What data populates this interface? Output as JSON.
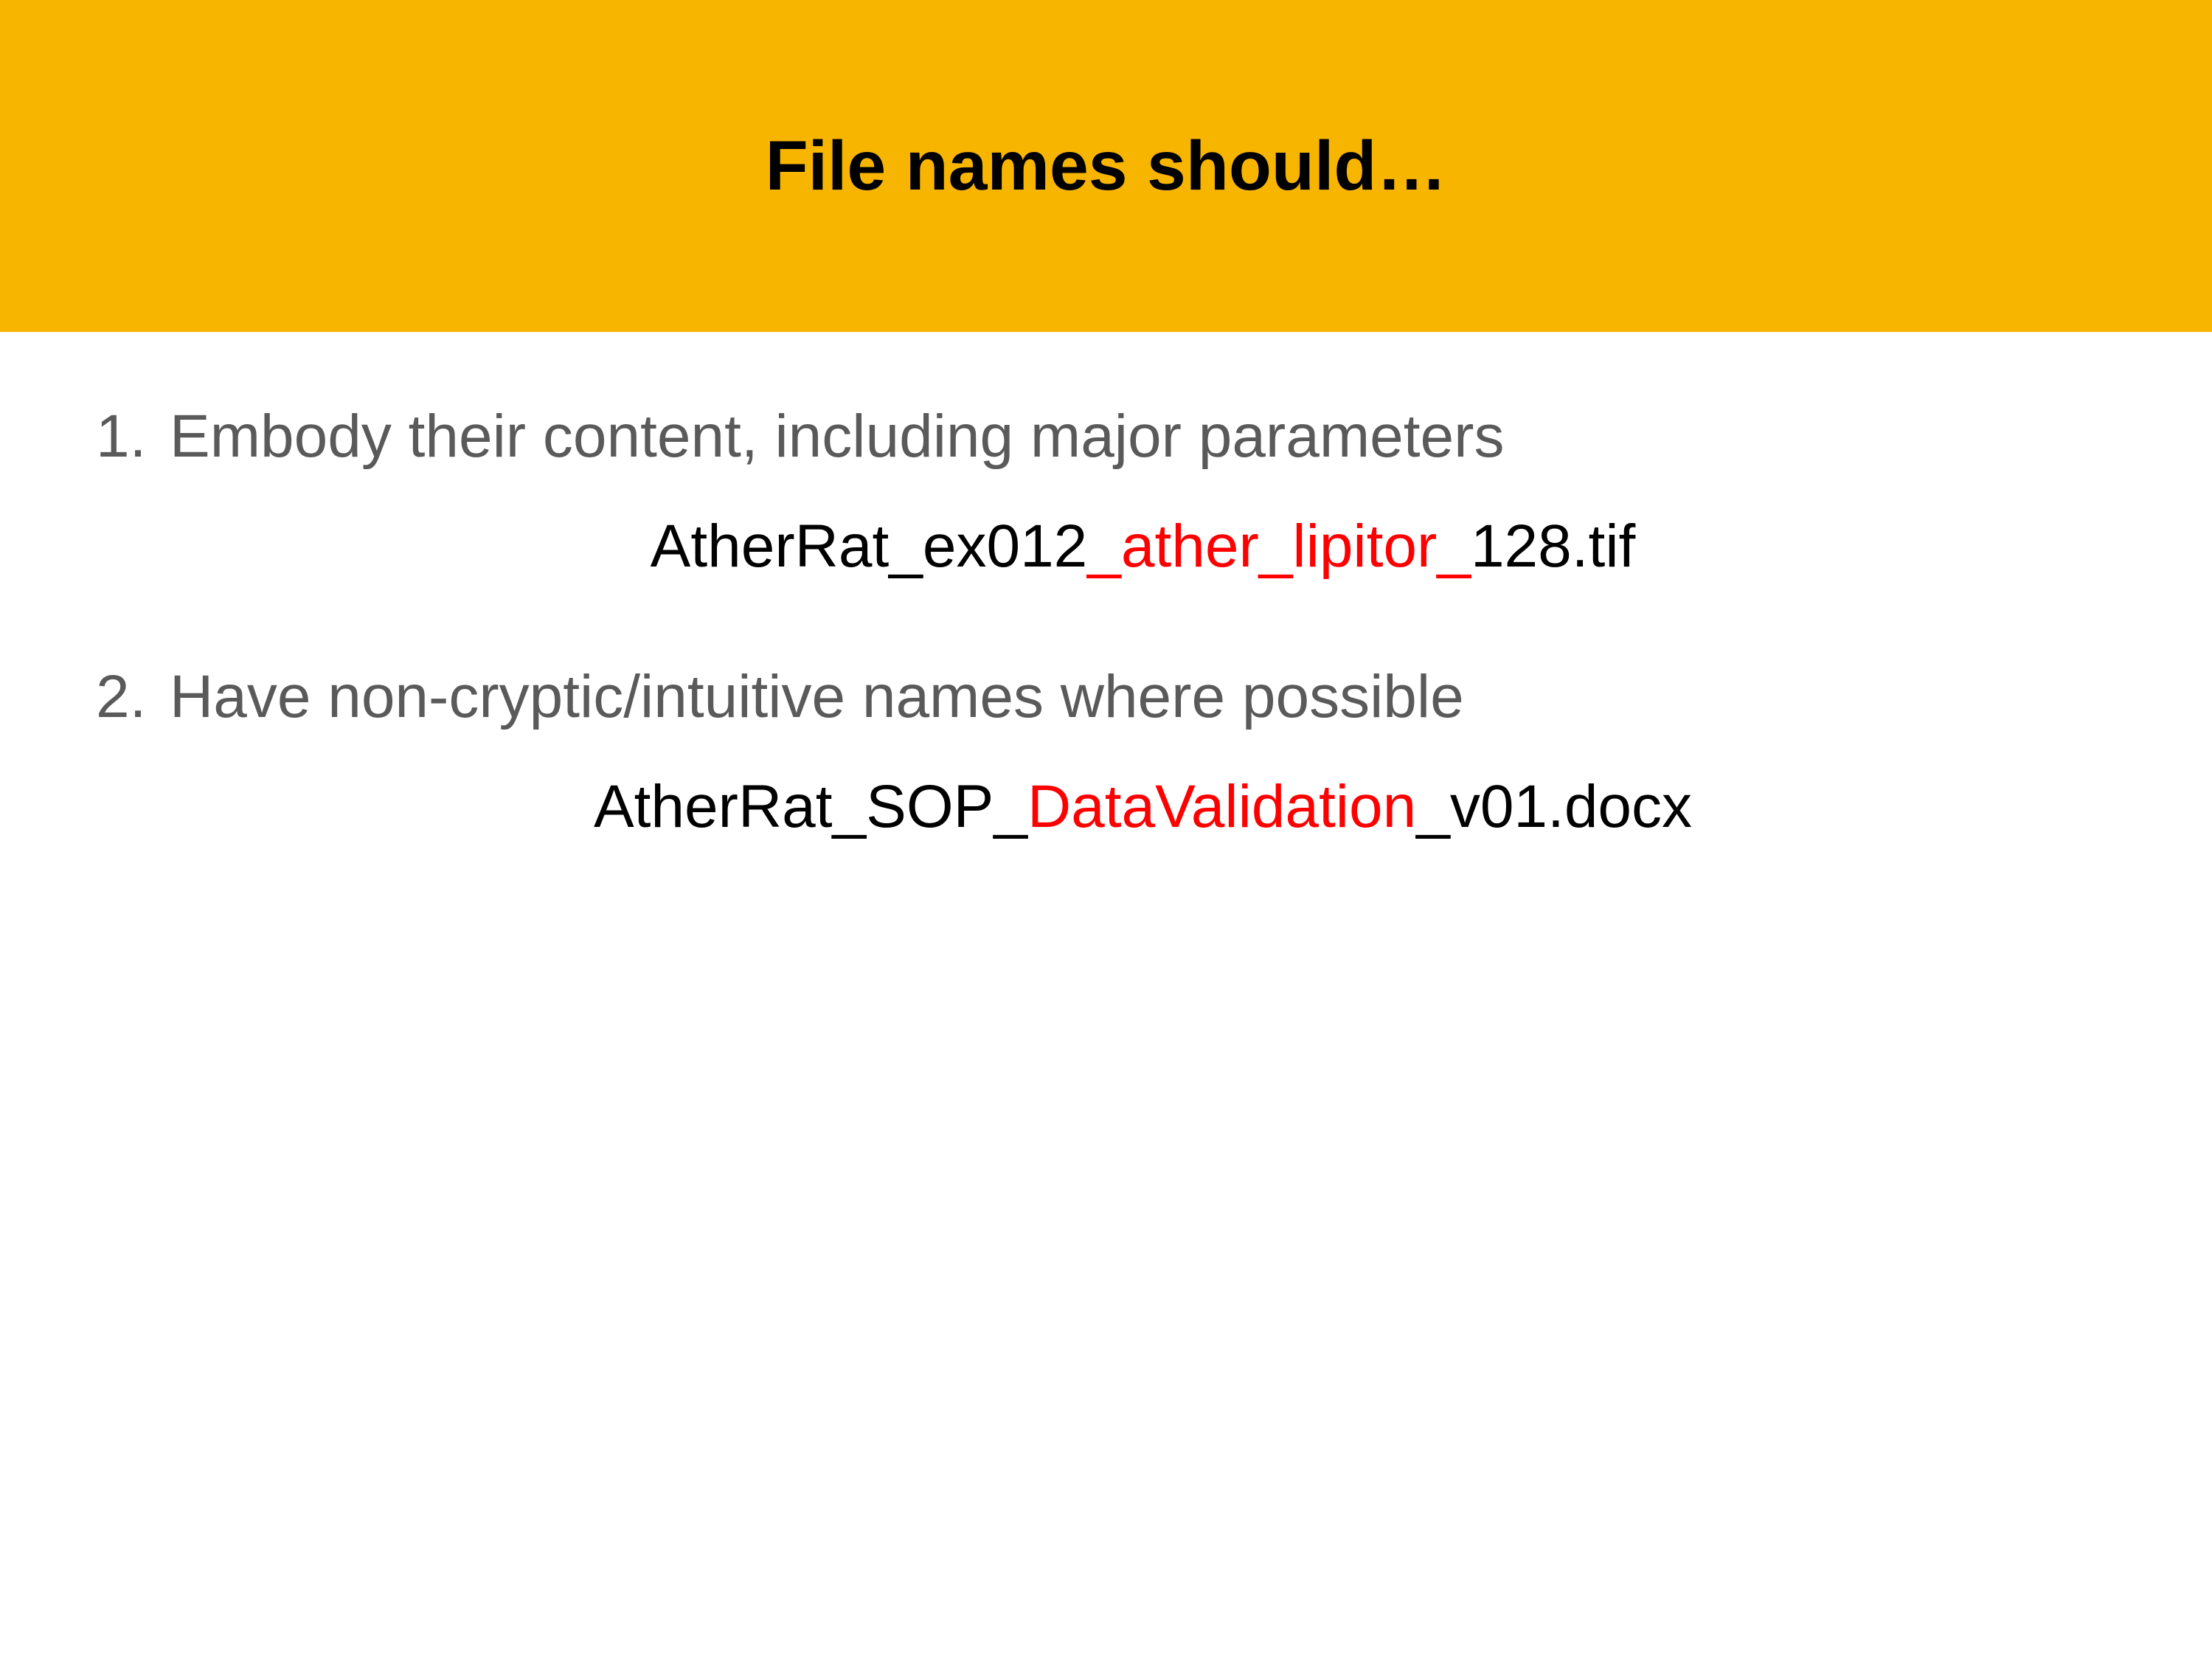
{
  "header": {
    "title": "File names should…"
  },
  "items": [
    {
      "number": "1.",
      "text": "Embody their content, including major parameters",
      "example": {
        "seg1": "AtherRat_ex012",
        "seg2_red": "_ather_lipitor_",
        "seg3": "128.tif"
      }
    },
    {
      "number": "2.",
      "text": "Have non-cryptic/intuitive names where possible",
      "example": {
        "seg1": "AtherRat_SOP_",
        "seg2_red": "DataValidation",
        "seg3": "_v01.docx"
      }
    }
  ]
}
